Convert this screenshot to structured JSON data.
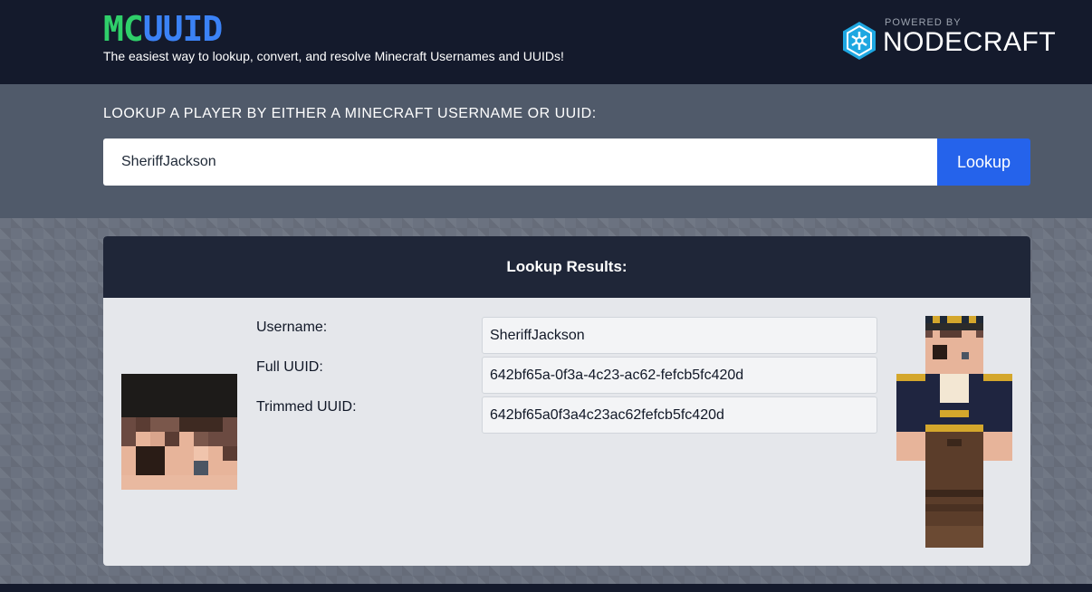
{
  "brand": {
    "logo_mc": "MC",
    "logo_uuid": "UUID",
    "tagline": "The easiest way to lookup, convert, and resolve Minecraft Usernames and UUIDs!",
    "powered_by": "POWERED BY",
    "partner": "NODECRAFT",
    "partner_icon": "nodecraft-hex-icon"
  },
  "search": {
    "label": "LOOKUP A PLAYER BY EITHER A MINECRAFT USERNAME OR UUID:",
    "value": "SheriffJackson",
    "button_label": "Lookup"
  },
  "results": {
    "title": "Lookup Results:",
    "fields": [
      {
        "label": "Username:",
        "value": "SheriffJackson"
      },
      {
        "label": "Full UUID:",
        "value": "642bf65a-0f3a-4c23-ac62-fefcb5fc420d"
      },
      {
        "label": "Trimmed UUID:",
        "value": "642bf65a0f3a4c23ac62fefcb5fc420d"
      }
    ]
  },
  "colors": {
    "header_bg": "#141a2c",
    "search_band_bg": "#505a6a",
    "accent_blue": "#2563eb",
    "logo_green": "#2fcf6a",
    "logo_blue": "#3b82f6"
  }
}
